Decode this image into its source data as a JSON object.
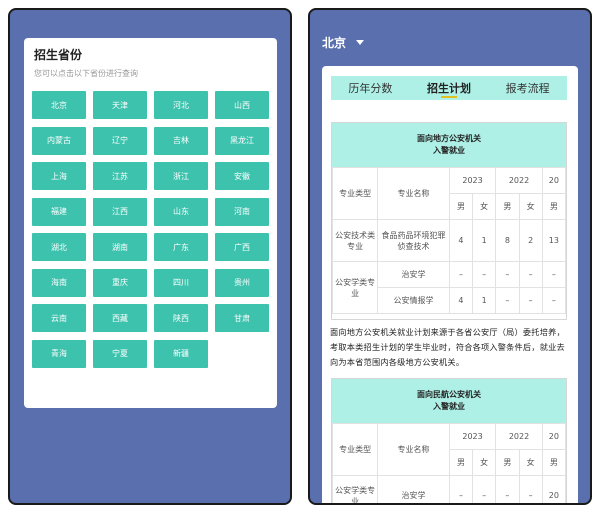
{
  "left_panel": {
    "title": "招生省份",
    "subtitle": "您可以点击以下省份进行查询",
    "provinces": [
      "北京",
      "天津",
      "河北",
      "山西",
      "内蒙古",
      "辽宁",
      "吉林",
      "黑龙江",
      "上海",
      "江苏",
      "浙江",
      "安徽",
      "福建",
      "江西",
      "山东",
      "河南",
      "湖北",
      "湖南",
      "广东",
      "广西",
      "海南",
      "重庆",
      "四川",
      "贵州",
      "云南",
      "西藏",
      "陕西",
      "甘肃",
      "青海",
      "宁夏",
      "新疆"
    ]
  },
  "right_panel": {
    "city": "北京",
    "tabs": [
      "历年分数",
      "招生计划",
      "报考流程"
    ],
    "active_tab": 1,
    "section1": {
      "header_line1": "面向地方公安机关",
      "header_line2": "入警就业",
      "col_type": "专业类型",
      "col_name": "专业名称",
      "years": [
        "2023",
        "2022",
        "20"
      ],
      "male": "男",
      "female": "女",
      "rows": [
        {
          "type": "公安技术类专业",
          "name": "食品药品环境犯罪侦查技术",
          "values": [
            "4",
            "1",
            "8",
            "2",
            "13"
          ]
        },
        {
          "type": "公安学类专业",
          "name": "治安学",
          "values": [
            "–",
            "–",
            "–",
            "–",
            "–"
          ]
        },
        {
          "type": "",
          "name": "公安情报学",
          "values": [
            "4",
            "1",
            "–",
            "–",
            "–"
          ]
        }
      ]
    },
    "description": "面向地方公安机关就业计划来源于各省公安厅（局）委托培养，考取本类招生计划的学生毕业时，符合各项入警条件后，就业去向为本省范围内各级地方公安机关。",
    "section2": {
      "header_line1": "面向民航公安机关",
      "header_line2": "入警就业",
      "col_type": "专业类型",
      "col_name": "专业名称",
      "years": [
        "2023",
        "2022",
        "20"
      ],
      "male": "男",
      "female": "女",
      "rows": [
        {
          "type": "公安学类专业",
          "name": "治安学",
          "values": [
            "–",
            "–",
            "–",
            "–",
            "20"
          ]
        }
      ]
    }
  }
}
